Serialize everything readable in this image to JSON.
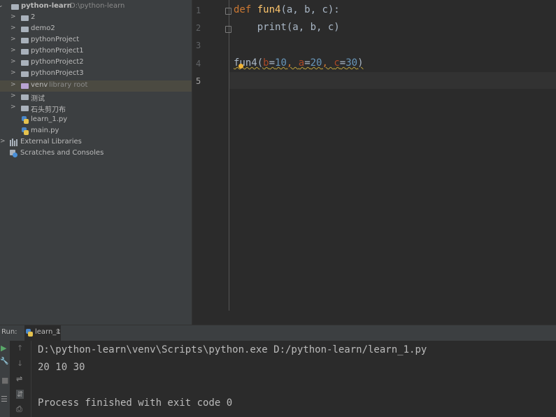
{
  "project": {
    "root": {
      "name": "python-learn",
      "path": "D:\\python-learn"
    },
    "items": [
      {
        "label": "2",
        "kind": "folder"
      },
      {
        "label": "demo2",
        "kind": "folder"
      },
      {
        "label": "pythonProject",
        "kind": "folder"
      },
      {
        "label": "pythonProject1",
        "kind": "folder"
      },
      {
        "label": "pythonProject2",
        "kind": "folder"
      },
      {
        "label": "pythonProject3",
        "kind": "folder"
      },
      {
        "label": "venv",
        "kind": "folder-excluded",
        "note": "library root",
        "selected": true
      },
      {
        "label": "测试",
        "kind": "folder"
      },
      {
        "label": "石头剪刀布",
        "kind": "folder"
      },
      {
        "label": "learn_1.py",
        "kind": "python-file"
      },
      {
        "label": "main.py",
        "kind": "python-file"
      }
    ],
    "external_libraries": "External Libraries",
    "scratches": "Scratches and Consoles"
  },
  "editor": {
    "line_numbers": [
      "1",
      "2",
      "3",
      "4",
      "5"
    ],
    "current_line": "5",
    "lines": [
      {
        "tokens": [
          {
            "t": "def ",
            "c": "kw"
          },
          {
            "t": "fun4",
            "c": "fn"
          },
          {
            "t": "(a, b, c):",
            "c": "plain"
          }
        ]
      },
      {
        "tokens": [
          {
            "t": "    print(a, b, c)",
            "c": "plain"
          }
        ]
      },
      {
        "tokens": []
      },
      {
        "tokens": [
          {
            "t": "fun4(",
            "c": "plain"
          },
          {
            "t": "b",
            "c": "param"
          },
          {
            "t": "=",
            "c": "plain"
          },
          {
            "t": "10",
            "c": "num"
          },
          {
            "t": ", ",
            "c": "kw"
          },
          {
            "t": "a",
            "c": "param"
          },
          {
            "t": "=",
            "c": "plain"
          },
          {
            "t": "20",
            "c": "num"
          },
          {
            "t": ", ",
            "c": "kw"
          },
          {
            "t": "c",
            "c": "param"
          },
          {
            "t": "=",
            "c": "plain"
          },
          {
            "t": "30",
            "c": "num"
          },
          {
            "t": ")",
            "c": "plain"
          }
        ]
      },
      {
        "tokens": []
      }
    ]
  },
  "run": {
    "label": "Run:",
    "tab": "learn_1",
    "tab_close": "×",
    "console": [
      "D:\\python-learn\\venv\\Scripts\\python.exe D:/python-learn/learn_1.py",
      "20 10 30",
      "",
      "Process finished with exit code 0"
    ],
    "tools": {
      "up": "↑",
      "down": "↓",
      "wrap": "⇌",
      "sort": "⇵",
      "print": "⎙"
    },
    "side": {
      "play": "▶",
      "wrench": "🔧",
      "stop": "■",
      "layout": "☰"
    }
  },
  "colors": {
    "keyword": "#cc7832",
    "function": "#ffc66d",
    "param": "#aa4926",
    "number": "#6897bb",
    "text": "#a9b7c6"
  }
}
